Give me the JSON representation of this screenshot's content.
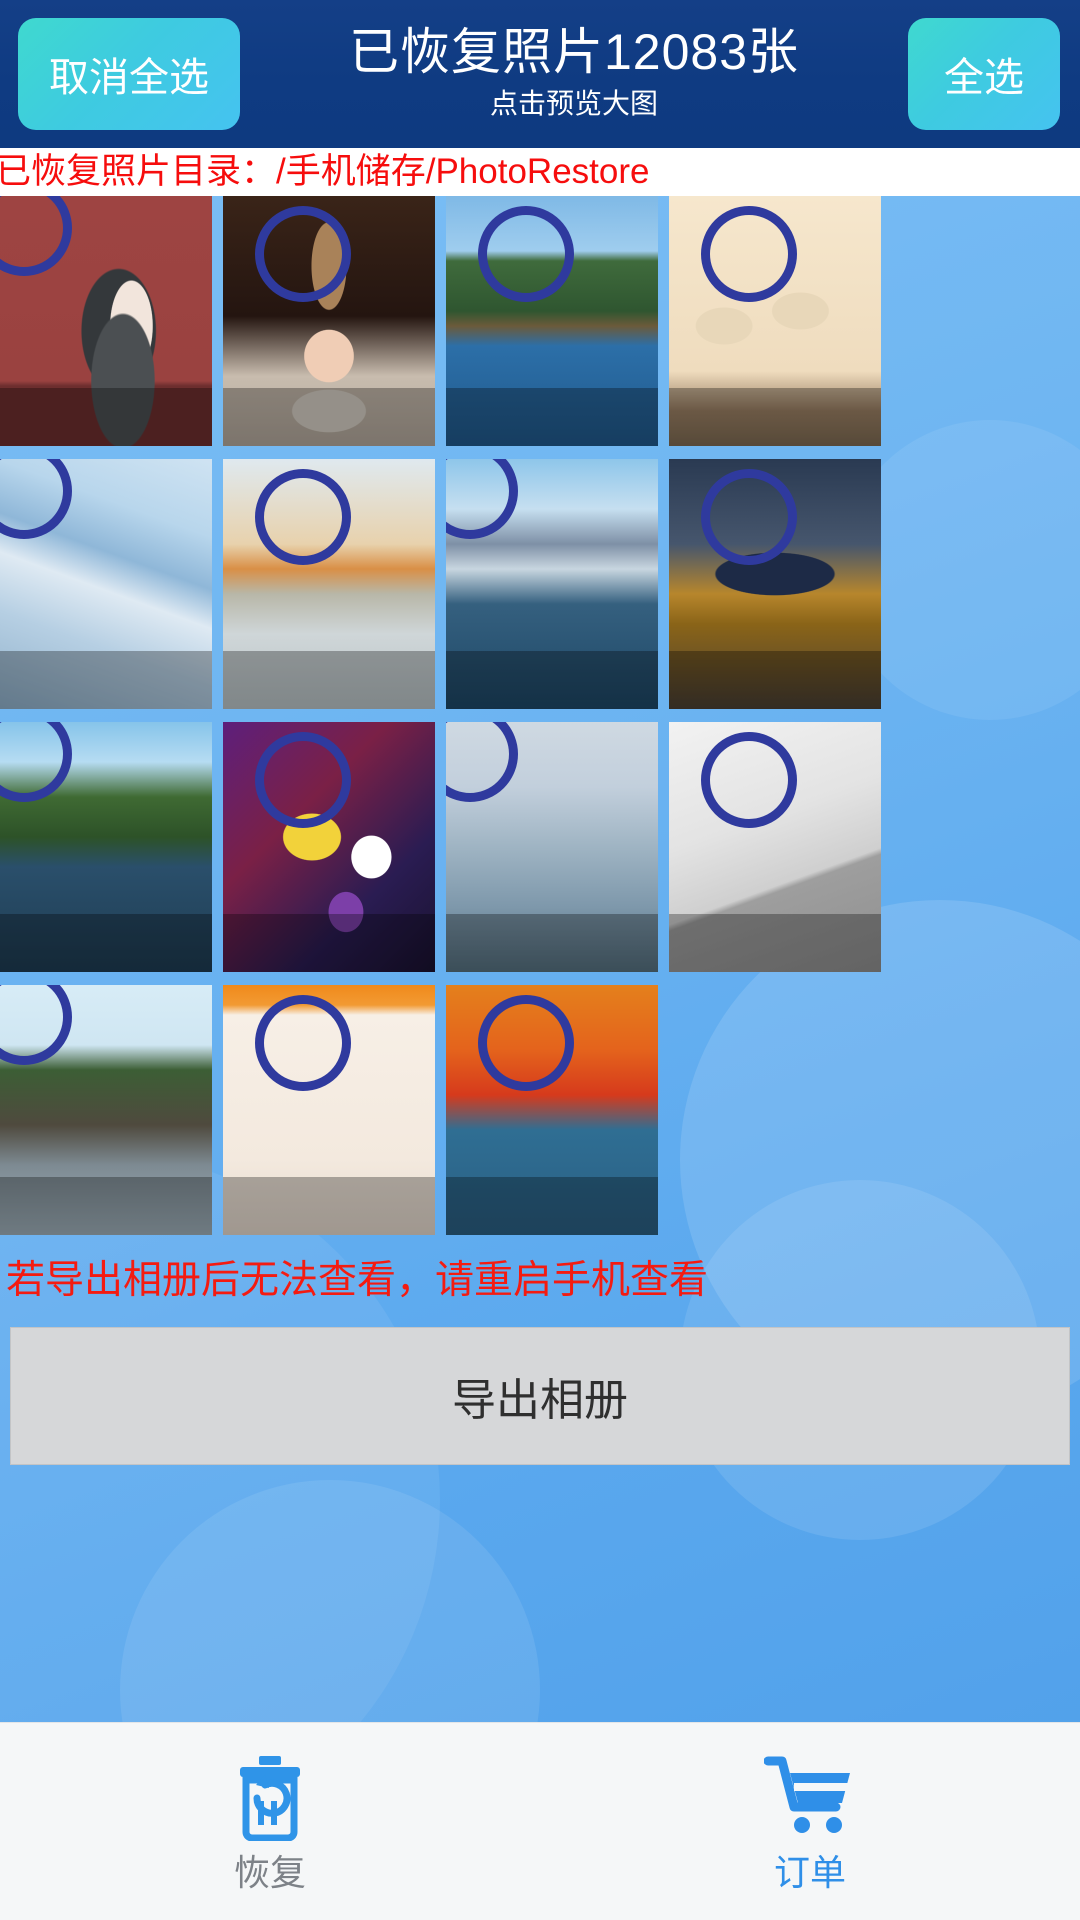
{
  "header": {
    "deselect_all_label": "取消全选",
    "title": "已恢复照片12083张",
    "subtitle": "点击预览大图",
    "select_all_label": "全选",
    "restored_count": 12083,
    "bg_color": "#0f3b82",
    "button_color": "#3ecbe0"
  },
  "directory_bar": {
    "text": "已恢复照片目录：/手机储存/PhotoRestore",
    "path": "/手机储存/PhotoRestore",
    "text_color": "#f60d0d",
    "bg_color": "#ffffff"
  },
  "grid": {
    "columns": 4,
    "selection_ring_color": "#2f3a9e",
    "items": [
      {
        "id": 1,
        "caption": "portrait-woman-red-background",
        "selected": false
      },
      {
        "id": 2,
        "caption": "baby-knit-hat-pinecone",
        "selected": false
      },
      {
        "id": 3,
        "caption": "beihai-white-pagoda-lake",
        "selected": false
      },
      {
        "id": 4,
        "caption": "photo-frame-wall-decor",
        "selected": false
      },
      {
        "id": 5,
        "caption": "iceberg-blue-ice",
        "selected": false
      },
      {
        "id": 6,
        "caption": "winter-sunset-trees-snow",
        "selected": false
      },
      {
        "id": 7,
        "caption": "chillon-castle-lake-alps",
        "selected": false
      },
      {
        "id": 8,
        "caption": "sports-car-autumn-leaves",
        "selected": false
      },
      {
        "id": 9,
        "caption": "lotus-pond-green-landscape",
        "selected": false
      },
      {
        "id": 10,
        "caption": "colorful-iris-flowers",
        "selected": false
      },
      {
        "id": 11,
        "caption": "tree-branches-cloudy-sky",
        "selected": false
      },
      {
        "id": 12,
        "caption": "scattered-polaroid-photos",
        "selected": false
      },
      {
        "id": 13,
        "caption": "tanah-lot-temple-sea",
        "selected": false
      },
      {
        "id": 14,
        "caption": "photo-tree-wall-sticker",
        "selected": false
      },
      {
        "id": 15,
        "caption": "autumn-maple-red-leaves",
        "selected": false
      }
    ]
  },
  "warning": {
    "text": "若导出相册后无法查看，请重启手机查看",
    "text_color": "#f41b11"
  },
  "export": {
    "label": "导出相册",
    "bg_color": "#d6d7d9"
  },
  "tabbar": {
    "items": [
      {
        "label": "恢复",
        "icon": "trash-restore-icon",
        "active": false,
        "color": "#7d8288"
      },
      {
        "label": "订单",
        "icon": "shopping-cart-icon",
        "active": true,
        "color": "#2f8fe8"
      }
    ]
  }
}
